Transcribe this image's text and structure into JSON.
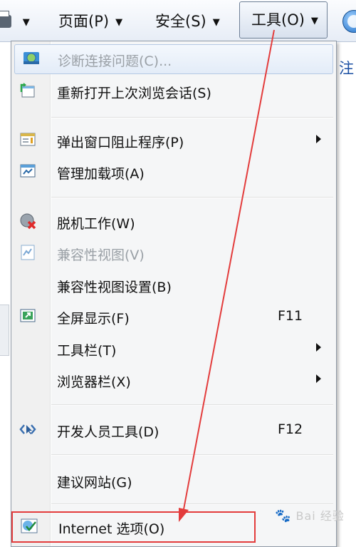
{
  "commandbar": {
    "page_label": "页面(P)",
    "safety_label": "安全(S)",
    "tools_label": "工具(O)",
    "arrow_glyph": "▼"
  },
  "background_page": {
    "side_text": "注"
  },
  "menu": {
    "items": [
      {
        "label": "诊断连接问题(C)...",
        "icon": "network-globe-icon",
        "disabled": true
      },
      {
        "label": "重新打开上次浏览会话(S)",
        "icon": "reopen-session-icon"
      },
      {
        "label": "弹出窗口阻止程序(P)",
        "icon": "popup-blocker-icon",
        "submenu": true
      },
      {
        "label": "管理加载项(A)",
        "icon": "addons-icon"
      },
      {
        "label": "脱机工作(W)",
        "icon": "work-offline-icon"
      },
      {
        "label": "兼容性视图(V)",
        "icon": "compat-view-icon",
        "disabled": true
      },
      {
        "label": "兼容性视图设置(B)"
      },
      {
        "label": "全屏显示(F)",
        "icon": "fullscreen-icon",
        "shortcut": "F11"
      },
      {
        "label": "工具栏(T)",
        "submenu": true
      },
      {
        "label": "浏览器栏(X)",
        "submenu": true
      },
      {
        "label": "开发人员工具(D)",
        "icon": "developer-tools-icon",
        "shortcut": "F12"
      },
      {
        "label": "建议网站(G)"
      },
      {
        "label": "Internet 选项(O)",
        "icon": "internet-options-icon"
      }
    ]
  },
  "annotation": {
    "arrow_color": "#e33c3c"
  },
  "watermark": {
    "text": "Bai 经验"
  }
}
